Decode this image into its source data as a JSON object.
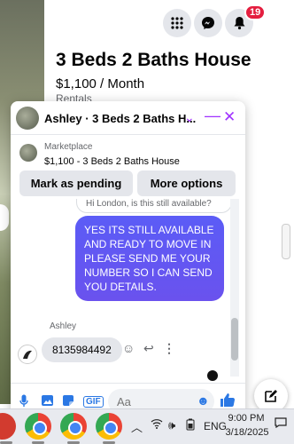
{
  "header": {
    "notification_count": "19"
  },
  "listing": {
    "title": "3 Beds 2 Baths House",
    "price": "$1,100 / Month",
    "category": "Rentals"
  },
  "chat": {
    "title": "Ashley · 3 Beds 2 Baths H...",
    "marketplace_label": "Marketplace",
    "marketplace_item": "$1,100 - 3 Beds 2 Baths House",
    "pending_label": "Mark as pending",
    "options_label": "More options",
    "incoming_preview": "Hi London, is this still available?",
    "outgoing_message": "YES ITS STILL AVAILABLE AND READY TO MOVE IN PLEASE SEND ME YOUR NUMBER SO I CAN SEND YOU DETAILS.",
    "sender_name": "Ashley",
    "incoming_message": "8135984492",
    "input_placeholder": "Aa",
    "gif_label": "GIF"
  },
  "taskbar": {
    "language": "ENG",
    "time": "9:00 PM",
    "date": "3/18/2025"
  },
  "colors": {
    "accent": "#a033ff",
    "bubble": "#5b5cf6",
    "badge": "#e41e3f",
    "messenger_blue": "#2b78e4"
  }
}
